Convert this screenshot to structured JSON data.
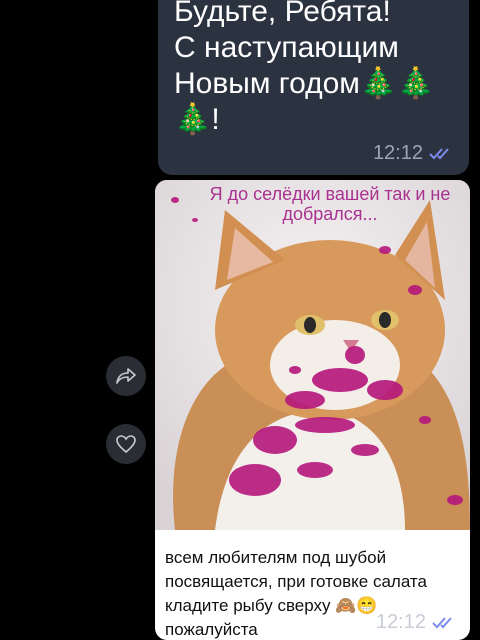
{
  "messages": {
    "top": {
      "text": "Будьте, Ребята!\nС наступающим\nНовым годом🎄🎄\n🎄!",
      "time": "12:12"
    },
    "image": {
      "overlay_text": "Я до селёдки вашей так и не добрался...",
      "caption": "всем любителям под шубой посвящается, при готовке салата кладите рыбу сверху 🙈😁 пожалуйста",
      "time": "12:12"
    }
  },
  "actions": {
    "share_icon": "share-arrow-icon",
    "like_icon": "heart-icon"
  },
  "colors": {
    "background": "#000000",
    "bubble": "#2b3240",
    "read_check": "#7c8cf0",
    "overlay_text": "#a9318f"
  }
}
